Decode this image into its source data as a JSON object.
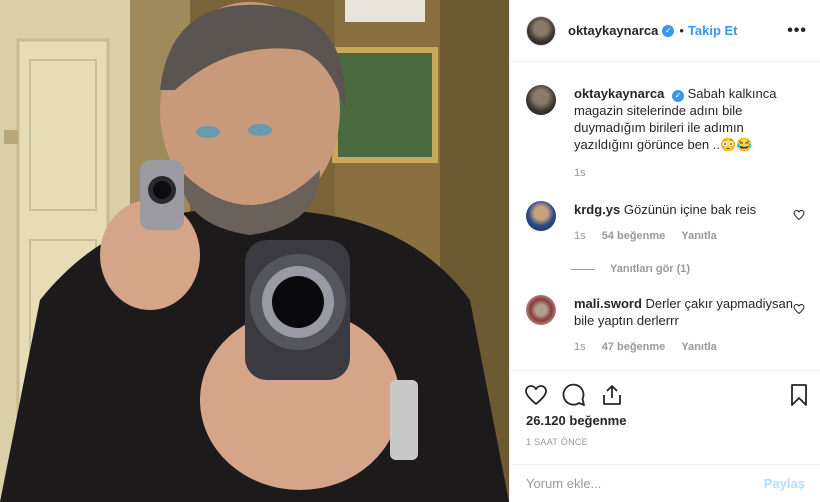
{
  "colors": {
    "link": "#3897f0",
    "muted": "#999999",
    "text": "#262626",
    "share_disabled": "#b2dffc"
  },
  "header": {
    "username": "oktaykaynarca",
    "separator": "•",
    "follow_label": "Takip Et",
    "more_label": "•••"
  },
  "caption": {
    "username": "oktaykaynarca",
    "text": "Sabah kalkınca magazin sitelerinde adını bile duymadığım birileri ile adımın yazıldığını görünce ben ..😳😂",
    "time": "1s"
  },
  "comments": [
    {
      "username": "krdg.ys",
      "text": "Gözünün içine bak reis",
      "time": "1s",
      "likes": "54 beğenme",
      "reply": "Yanıtla"
    },
    {
      "username": "mali.sword",
      "text": "Derler çakır yapmadiysan bile yaptın derlerrr",
      "time": "1s",
      "likes": "47 beğenme",
      "reply": "Yanıtla"
    }
  ],
  "view_replies": "Yanıtları gör (1)",
  "post": {
    "likes": "26.120 beğenme",
    "time": "1 SAAT ÖNCE"
  },
  "add_comment": {
    "placeholder": "Yorum ekle...",
    "submit_label": "Paylaş"
  },
  "icons": [
    "verified-badge-icon",
    "heart-icon",
    "comment-icon",
    "share-icon",
    "bookmark-icon",
    "more-options-icon"
  ]
}
